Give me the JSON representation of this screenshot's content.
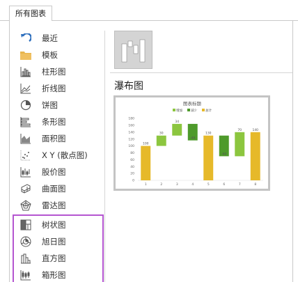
{
  "tab": {
    "label": "所有图表"
  },
  "nav": {
    "items": [
      {
        "label": "最近",
        "icon": "recent-arrow-icon"
      },
      {
        "label": "模板",
        "icon": "folder-icon"
      },
      {
        "label": "柱形图",
        "icon": "column-chart-icon"
      },
      {
        "label": "折线图",
        "icon": "line-chart-icon"
      },
      {
        "label": "饼图",
        "icon": "pie-chart-icon"
      },
      {
        "label": "条形图",
        "icon": "bar-chart-icon"
      },
      {
        "label": "面积图",
        "icon": "area-chart-icon"
      },
      {
        "label": "X Y (散点图)",
        "icon": "scatter-chart-icon"
      },
      {
        "label": "股价图",
        "icon": "stock-chart-icon"
      },
      {
        "label": "曲面图",
        "icon": "surface-chart-icon"
      },
      {
        "label": "雷达图",
        "icon": "radar-chart-icon"
      },
      {
        "label": "树状图",
        "icon": "treemap-icon"
      },
      {
        "label": "旭日图",
        "icon": "sunburst-icon"
      },
      {
        "label": "直方图",
        "icon": "histogram-icon"
      },
      {
        "label": "箱形图",
        "icon": "box-whisker-icon"
      }
    ]
  },
  "section": {
    "title": "瀑布图"
  },
  "thumbnail": {
    "icon": "waterfall-chart-icon"
  },
  "colors": {
    "increase": "#8cc63f",
    "decrease": "#4e9a2b",
    "total": "#e6b92a",
    "highlight": "#b455d0"
  },
  "chart_data": {
    "type": "bar",
    "subtype": "waterfall",
    "title": "图表标题",
    "legend": [
      "增加",
      "减少",
      "总计"
    ],
    "categories": [
      "1",
      "2",
      "3",
      "4",
      "5",
      "6",
      "7",
      "8"
    ],
    "values": [
      100,
      30,
      34,
      -48,
      130,
      -60,
      70,
      140
    ],
    "kinds": [
      "total",
      "increase",
      "increase",
      "decrease",
      "total",
      "decrease",
      "increase",
      "total"
    ],
    "data_labels": [
      "100",
      "30",
      "34",
      "-48",
      "130",
      "-60",
      "70",
      "140"
    ],
    "yticks": [
      "180",
      "160",
      "140",
      "120",
      "100",
      "80",
      "60",
      "40",
      "20",
      "0"
    ],
    "ylim": [
      0,
      180
    ],
    "grid": false,
    "legend_position": "top"
  }
}
